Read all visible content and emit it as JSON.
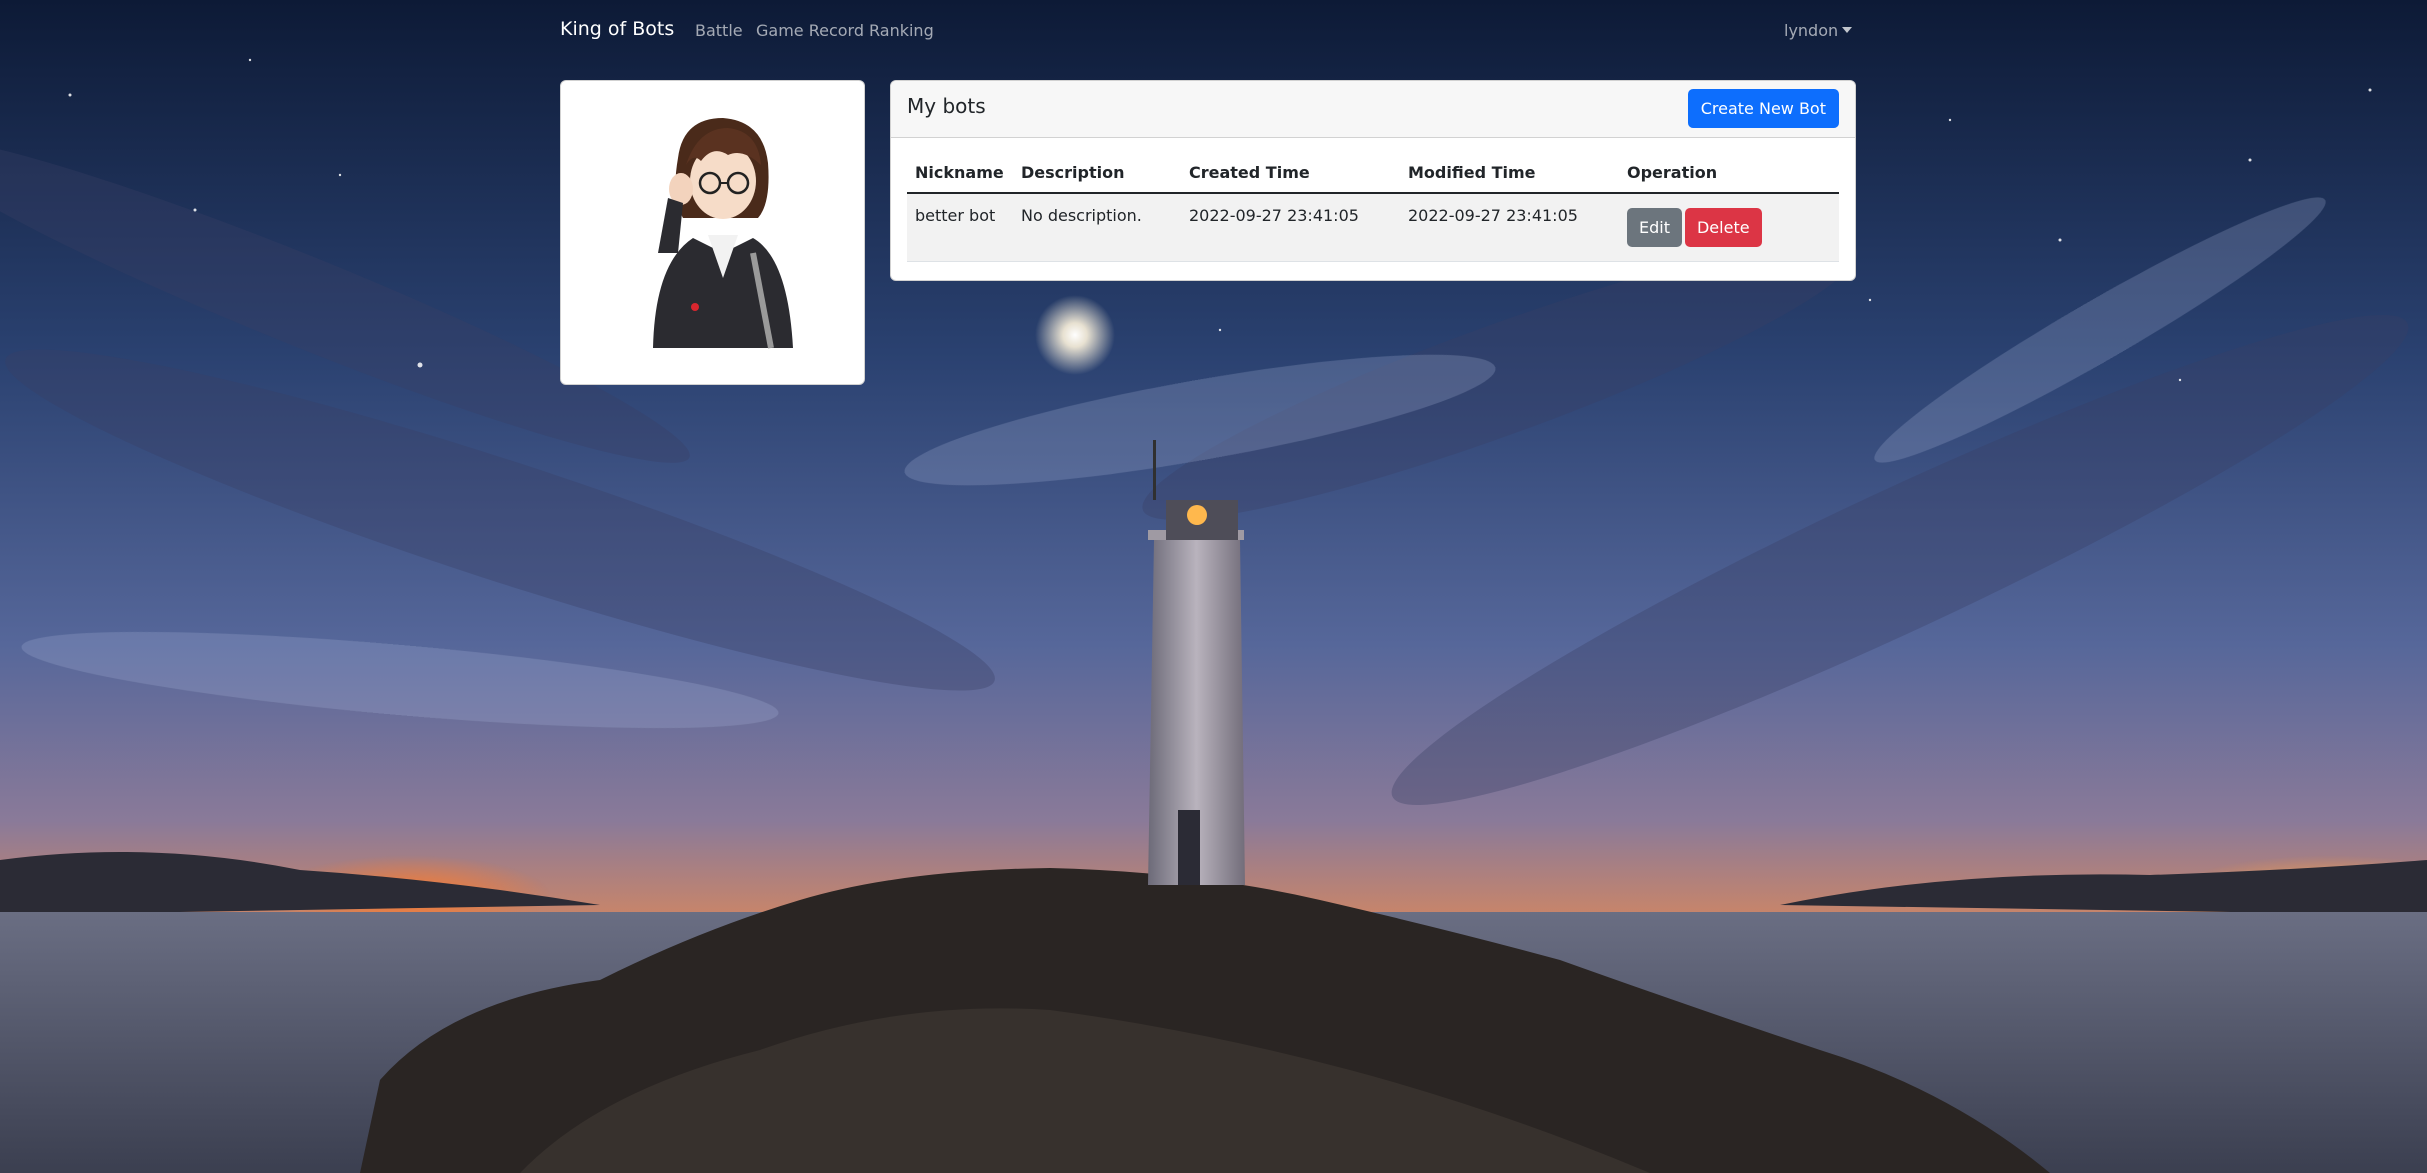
{
  "navbar": {
    "brand": "King of Bots",
    "links": [
      "Battle",
      "Game Record",
      "Ranking"
    ],
    "user": "lyndon"
  },
  "bots_card": {
    "title": "My bots",
    "create_button": "Create New Bot",
    "columns": [
      "Nickname",
      "Description",
      "Created Time",
      "Modified Time",
      "Operation"
    ],
    "rows": [
      {
        "nickname": "better bot",
        "description": "No description.",
        "created": "2022-09-27 23:41:05",
        "modified": "2022-09-27 23:41:05",
        "edit_label": "Edit",
        "delete_label": "Delete"
      }
    ]
  },
  "colors": {
    "primary": "#0d6efd",
    "secondary": "#6c757d",
    "danger": "#dc3545"
  }
}
